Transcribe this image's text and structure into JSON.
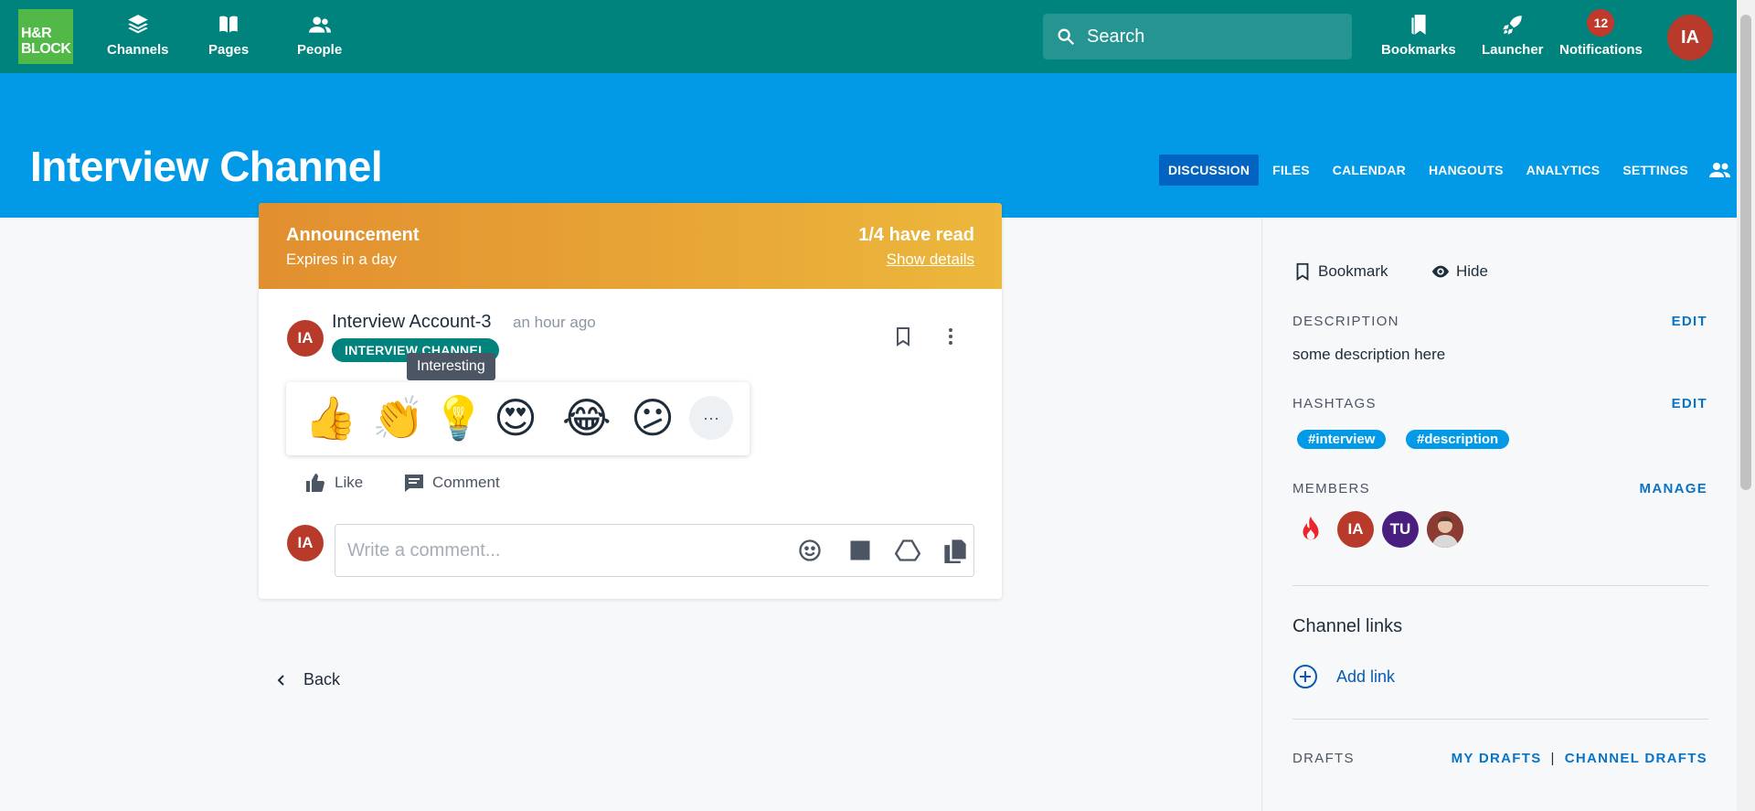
{
  "topbar": {
    "logo_text": "H&R BLOCK",
    "nav": [
      {
        "label": "Channels",
        "icon": "layers-icon"
      },
      {
        "label": "Pages",
        "icon": "book-icon"
      },
      {
        "label": "People",
        "icon": "people-icon"
      }
    ],
    "search_label": "Search",
    "right_nav": [
      {
        "label": "Bookmarks",
        "icon": "bookmarks-icon"
      },
      {
        "label": "Launcher",
        "icon": "rocket-icon"
      },
      {
        "label": "Notifications",
        "icon": "bell-icon",
        "badge": "12"
      }
    ],
    "avatar_initials": "IA"
  },
  "header": {
    "title": "Interview Channel",
    "tabs": [
      "DISCUSSION",
      "FILES",
      "CALENDAR",
      "HANGOUTS",
      "ANALYTICS",
      "SETTINGS"
    ],
    "active_tab": "DISCUSSION",
    "member_count": "4"
  },
  "announcement": {
    "title": "Announcement",
    "subtitle": "Expires in a day",
    "read_status": "1/4 have read",
    "details_link": "Show details"
  },
  "post": {
    "avatar_initials": "IA",
    "author": "Interview Account-3",
    "time": "an hour ago",
    "channel_badge": "INTERVIEW CHANNEL",
    "tooltip": "Interesting",
    "reactions": [
      "👍",
      "👏",
      "💡",
      "😍",
      "😂",
      "😕"
    ],
    "more_reactions": "···",
    "like_label": "Like",
    "comment_label": "Comment"
  },
  "comment": {
    "avatar_initials": "IA",
    "placeholder": "Write a comment..."
  },
  "back_label": "Back",
  "sidebar": {
    "bookmark_label": "Bookmark",
    "hide_label": "Hide",
    "description_label": "DESCRIPTION",
    "description_edit": "EDIT",
    "description_text": "some description here",
    "hashtags_label": "HASHTAGS",
    "hashtags_edit": "EDIT",
    "hashtags": [
      "#interview",
      "#description"
    ],
    "members_label": "MEMBERS",
    "members_manage": "MANAGE",
    "members": [
      {
        "initials": "",
        "kind": "fire",
        "color": "#ffffff"
      },
      {
        "initials": "IA",
        "kind": "initials",
        "color": "#b83a2b"
      },
      {
        "initials": "TU",
        "kind": "initials",
        "color": "#4a1e7e"
      },
      {
        "initials": "",
        "kind": "photo",
        "color": "#c44a3c"
      }
    ],
    "channel_links_heading": "Channel links",
    "add_link_label": "Add link",
    "drafts_label": "DRAFTS",
    "my_drafts": "MY DRAFTS",
    "drafts_separator": "|",
    "channel_drafts": "CHANNEL DRAFTS"
  }
}
